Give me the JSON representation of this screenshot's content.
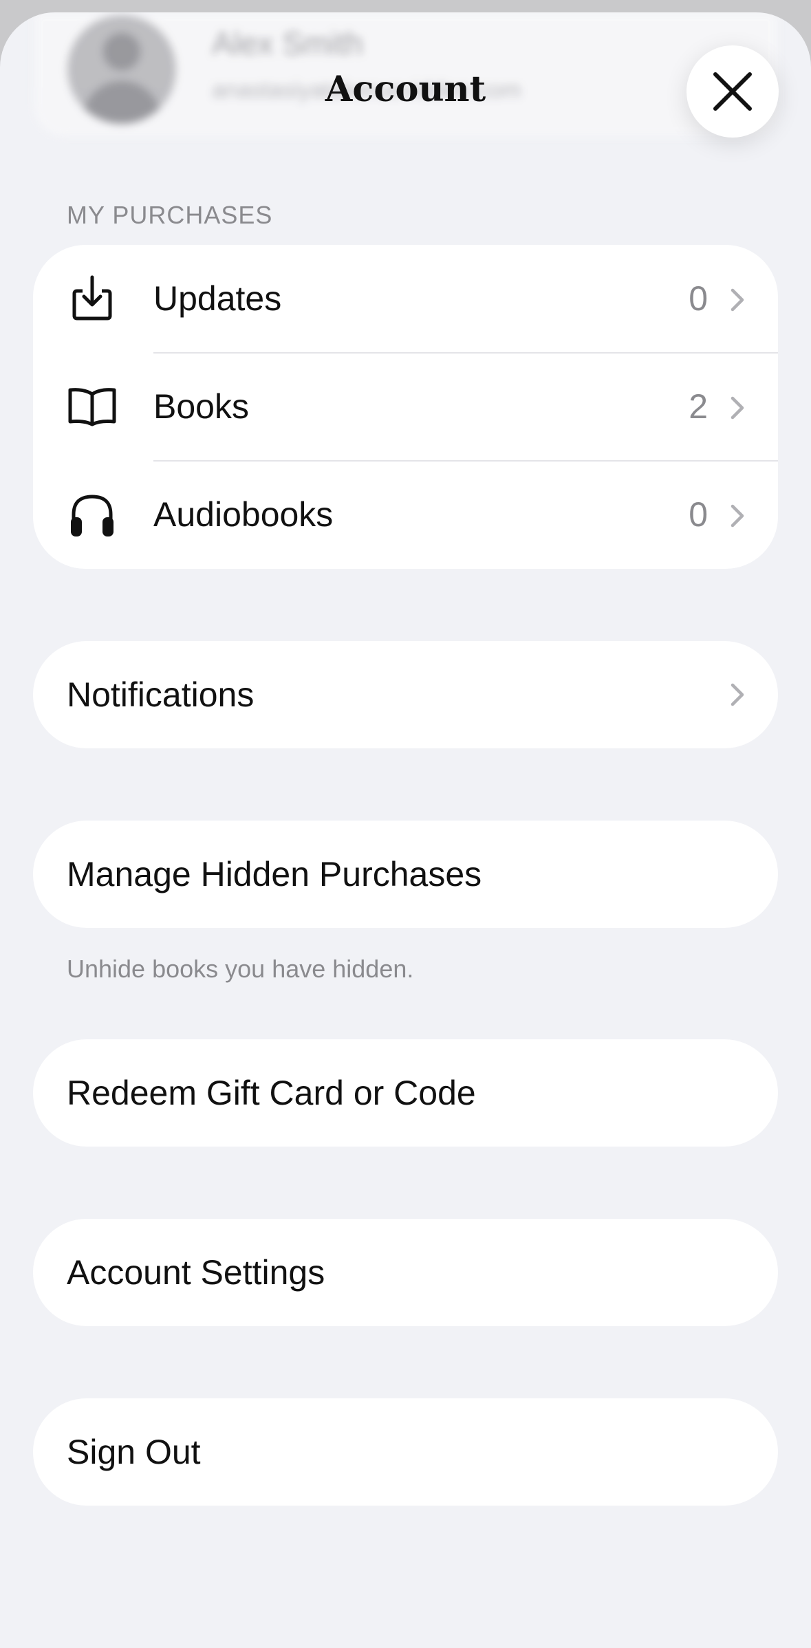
{
  "profile": {
    "name": "Alex Smith",
    "email": "anastasiyatakeruevidden.com"
  },
  "header": {
    "title": "Account",
    "close_icon": "close-icon"
  },
  "purchases": {
    "section_title": "MY PURCHASES",
    "items": [
      {
        "label": "Updates",
        "count": "0",
        "icon": "download-tray-icon"
      },
      {
        "label": "Books",
        "count": "2",
        "icon": "open-book-icon"
      },
      {
        "label": "Audiobooks",
        "count": "0",
        "icon": "headphones-icon"
      }
    ]
  },
  "notifications": {
    "label": "Notifications"
  },
  "hidden_purchases": {
    "label": "Manage Hidden Purchases",
    "footnote": "Unhide books you have hidden."
  },
  "redeem": {
    "label": "Redeem Gift Card or Code"
  },
  "account_settings": {
    "label": "Account Settings"
  },
  "sign_out": {
    "label": "Sign Out"
  },
  "colors": {
    "background": "#f1f2f6",
    "card": "#ffffff",
    "secondary_text": "#8a8a8e",
    "primary_text": "#111111"
  }
}
